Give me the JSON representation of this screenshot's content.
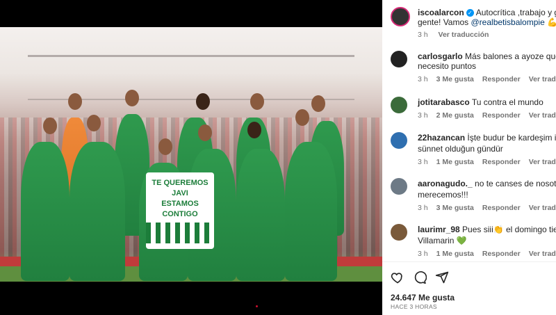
{
  "post": {
    "author": "iscoalarcon",
    "caption": "Autocrítica ,trabajo y gana",
    "caption_line2": "gente! Vamos",
    "mention": "@realbetisbalompie",
    "emojis": "💪💚",
    "time": "3 h",
    "translate": "Ver traducción",
    "banner_lines": [
      "TE QUEREMOS",
      "JAVI",
      "ESTAMOS",
      "CONTIGO"
    ]
  },
  "comments": [
    {
      "user": "carlosgarlo",
      "text": "Más balones a ayoze que lo t",
      "text2": "necesito puntos",
      "time": "3 h",
      "likes": "3 Me gusta",
      "reply": "Responder",
      "translate": "Ver traducción",
      "avatar_color": "#222222"
    },
    {
      "user": "jotitarabasco",
      "text": "Tu contra el mundo",
      "text2": "",
      "time": "3 h",
      "likes": "2 Me gusta",
      "reply": "Responder",
      "translate": "Ver traducción",
      "avatar_color": "#3b6b3a"
    },
    {
      "user": "22hazancan",
      "text": "İşte budur be kardeşim işte b",
      "text2": "sünnet olduğun gündür",
      "time": "3 h",
      "likes": "1 Me gusta",
      "reply": "Responder",
      "translate": "Ver traducción",
      "avatar_color": "#2f6fb0"
    },
    {
      "user": "aaronagudo._",
      "text": "no te canses de nosotros",
      "text2": "merecemos!!!",
      "time": "3 h",
      "likes": "3 Me gusta",
      "reply": "Responder",
      "translate": "Ver traducción",
      "avatar_color": "#6d7a86"
    },
    {
      "user": "laurimr_98",
      "text": "Pues siii👏 el domingo tiene",
      "text2": "Villamarin 💚",
      "time": "3 h",
      "likes": "1 Me gusta",
      "reply": "Responder",
      "translate": "Ver traducción",
      "avatar_color": "#7a5a3a"
    }
  ],
  "footer": {
    "likes": "24.647 Me gusta",
    "ago": "HACE 3 HORAS",
    "icons": [
      "heart-icon",
      "comment-icon",
      "share-icon"
    ]
  }
}
